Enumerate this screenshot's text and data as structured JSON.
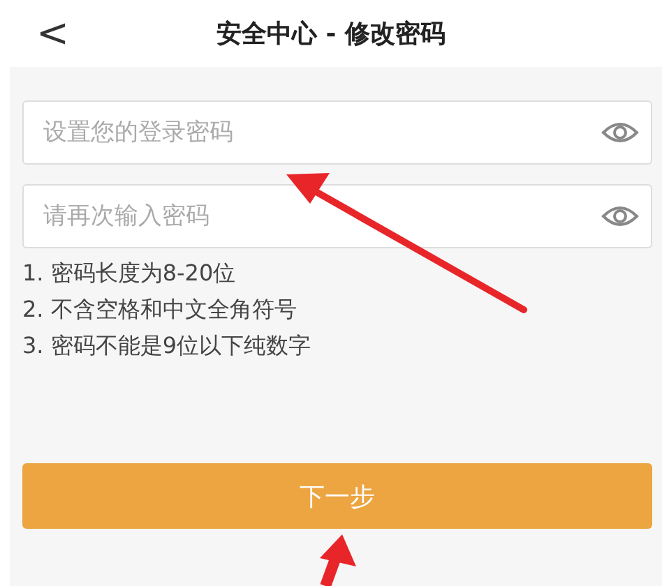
{
  "header": {
    "back": "<",
    "title": "安全中心 - 修改密码"
  },
  "fields": [
    {
      "placeholder": "设置您的登录密码"
    },
    {
      "placeholder": "请再次输入密码"
    }
  ],
  "rules": [
    "1. 密码长度为8-20位",
    "2. 不含空格和中文全角符号",
    "3. 密码不能是9位以下纯数字"
  ],
  "button": "下一步"
}
